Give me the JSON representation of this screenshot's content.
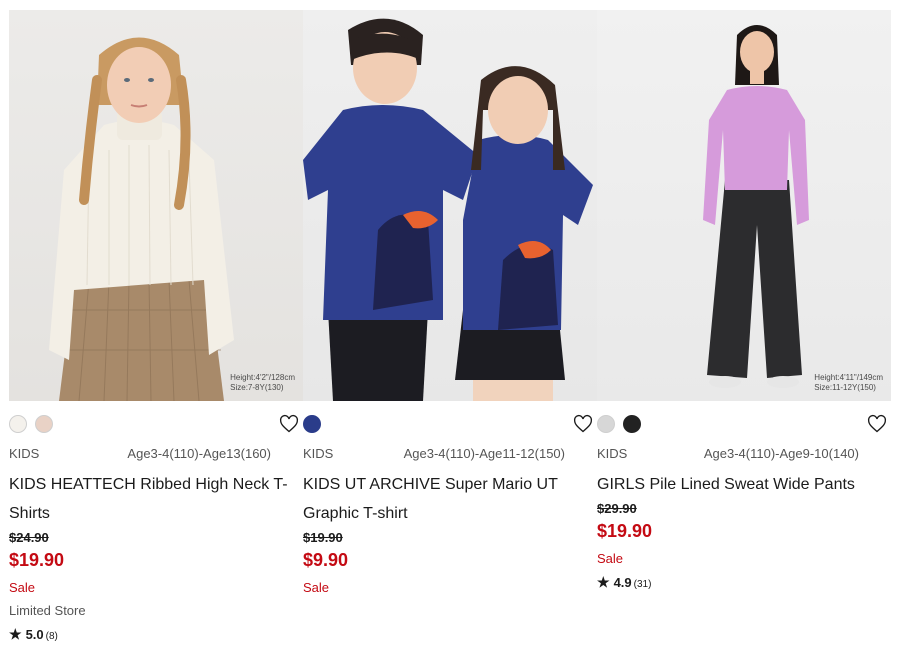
{
  "products": [
    {
      "fit_note": [
        "Height:4'2\"/128cm",
        "Size:7-8Y(130)"
      ],
      "colors": [
        "#f4f1ec",
        "#e9d2c6"
      ],
      "category": "KIDS",
      "sizes": "Age3-4(110)-Age13(160)",
      "name": "KIDS HEATTECH Ribbed High Neck T-Shirts",
      "original_price": "$24.90",
      "price": "$19.90",
      "sale_label": "Sale",
      "store_note": "Limited Store",
      "rating": "5.0",
      "review_count": "(8)",
      "favorite_icon": "heart-outline-icon"
    },
    {
      "fit_note": [],
      "colors": [
        "#2a3c8a"
      ],
      "category": "KIDS",
      "sizes": "Age3-4(110)-Age11-12(150)",
      "name": "KIDS UT ARCHIVE Super Mario UT Graphic T-shirt",
      "original_price": "$19.90",
      "price": "$9.90",
      "sale_label": "Sale",
      "store_note": "",
      "rating": "",
      "review_count": "",
      "favorite_icon": "heart-outline-icon"
    },
    {
      "fit_note": [
        "Height:4'11\"/149cm",
        "Size:11-12Y(150)"
      ],
      "colors": [
        "#d7d7d7",
        "#222222"
      ],
      "category": "KIDS",
      "sizes": "Age3-4(110)-Age9-10(140)",
      "name": "GIRLS Pile Lined Sweat Wide Pants",
      "original_price": "$29.90",
      "price": "$19.90",
      "sale_label": "Sale",
      "store_note": "",
      "rating": "4.9",
      "review_count": "(31)",
      "favorite_icon": "heart-outline-icon"
    }
  ]
}
